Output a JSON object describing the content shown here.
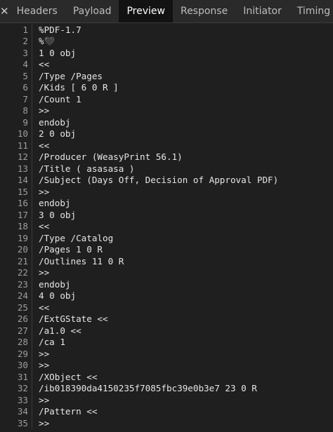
{
  "tabs": {
    "close_glyph": "✕",
    "headers": "Headers",
    "payload": "Payload",
    "preview": "Preview",
    "response": "Response",
    "initiator": "Initiator",
    "timing": "Timing",
    "active": "Preview"
  },
  "colors": {
    "background": "#1f1f1f",
    "tabbar": "#2a2a2a",
    "active_tab": "#121212",
    "line_number": "#9e9e9e",
    "code_text": "#e6e6e6"
  },
  "lines": [
    {
      "n": "1",
      "text": "%PDF-1.7"
    },
    {
      "n": "2",
      "text": "%🖤"
    },
    {
      "n": "3",
      "text": "1 0 obj"
    },
    {
      "n": "4",
      "text": "<<"
    },
    {
      "n": "5",
      "text": "/Type /Pages"
    },
    {
      "n": "6",
      "text": "/Kids [ 6 0 R ]"
    },
    {
      "n": "7",
      "text": "/Count 1"
    },
    {
      "n": "8",
      "text": ">>"
    },
    {
      "n": "9",
      "text": "endobj"
    },
    {
      "n": "10",
      "text": "2 0 obj"
    },
    {
      "n": "11",
      "text": "<<"
    },
    {
      "n": "12",
      "text": "/Producer (WeasyPrint 56.1)"
    },
    {
      "n": "13",
      "text": "/Title ( asasasa )"
    },
    {
      "n": "14",
      "text": "/Subject (Days Off, Decision of Approval PDF)"
    },
    {
      "n": "15",
      "text": ">>"
    },
    {
      "n": "16",
      "text": "endobj"
    },
    {
      "n": "17",
      "text": "3 0 obj"
    },
    {
      "n": "18",
      "text": "<<"
    },
    {
      "n": "19",
      "text": "/Type /Catalog"
    },
    {
      "n": "20",
      "text": "/Pages 1 0 R"
    },
    {
      "n": "21",
      "text": "/Outlines 11 0 R"
    },
    {
      "n": "22",
      "text": ">>"
    },
    {
      "n": "23",
      "text": "endobj"
    },
    {
      "n": "24",
      "text": "4 0 obj"
    },
    {
      "n": "25",
      "text": "<<"
    },
    {
      "n": "26",
      "text": "/ExtGState <<"
    },
    {
      "n": "27",
      "text": "/a1.0 <<"
    },
    {
      "n": "28",
      "text": "/ca 1"
    },
    {
      "n": "29",
      "text": ">>"
    },
    {
      "n": "30",
      "text": ">>"
    },
    {
      "n": "31",
      "text": "/XObject <<"
    },
    {
      "n": "32",
      "text": "/ib018390da4150235f7085fbc39e0b3e7 23 0 R"
    },
    {
      "n": "33",
      "text": ">>"
    },
    {
      "n": "34",
      "text": "/Pattern <<"
    },
    {
      "n": "35",
      "text": ">>"
    }
  ]
}
